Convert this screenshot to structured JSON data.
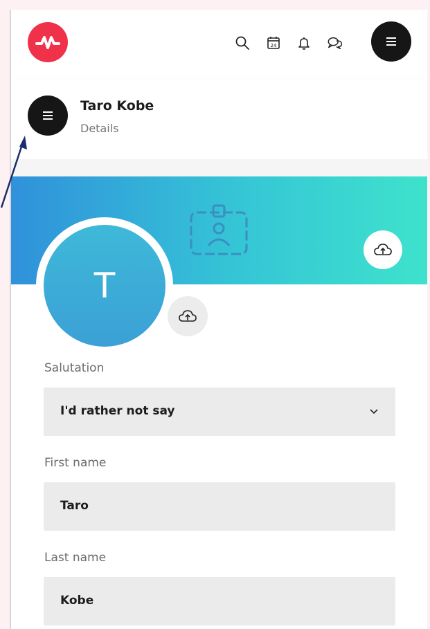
{
  "topbar": {
    "icons": [
      "logo-wave-icon",
      "search-icon",
      "calendar-icon",
      "bell-icon",
      "chat-icon",
      "menu-icon"
    ],
    "calendar_day": "24"
  },
  "profile": {
    "name": "Taro Kobe",
    "subtitle": "Details",
    "avatar_letter": "T"
  },
  "form": {
    "salutation_label": "Salutation",
    "salutation_value": "I'd rather not say",
    "first_name_label": "First name",
    "first_name_value": "Taro",
    "last_name_label": "Last name",
    "last_name_value": "Kobe"
  },
  "colors": {
    "brand": "#f0314a",
    "banner_start": "#3091db",
    "banner_end": "#3ee2cc",
    "annotation_arrow": "#1c2d6b"
  }
}
